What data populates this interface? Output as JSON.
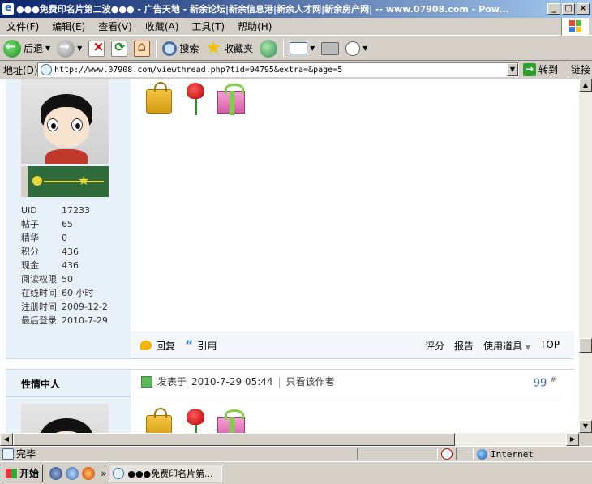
{
  "window": {
    "title": "●●●免费印名片第二波●●● - 广告天地 - 新余论坛|新余信息港|新余人才网|新余房产网| -- www.07908.com - Pow..."
  },
  "menu": [
    "文件(F)",
    "编辑(E)",
    "查看(V)",
    "收藏(A)",
    "工具(T)",
    "帮助(H)"
  ],
  "toolbar": {
    "back": "后退",
    "search": "搜索",
    "favorites": "收藏夹"
  },
  "address": {
    "label": "地址(D)",
    "url": "http://www.07908.com/viewthread.php?tid=94795&extra=&page=5",
    "go": "转到",
    "links": "链接"
  },
  "post1": {
    "stats": [
      {
        "k": "UID",
        "v": "17233"
      },
      {
        "k": "帖子",
        "v": "65"
      },
      {
        "k": "精华",
        "v": "0"
      },
      {
        "k": "积分",
        "v": "436"
      },
      {
        "k": "现金",
        "v": "436"
      },
      {
        "k": "阅读权限",
        "v": "50"
      },
      {
        "k": "在线时间",
        "v": "60 小时"
      },
      {
        "k": "注册时间",
        "v": "2009-12-2"
      },
      {
        "k": "最后登录",
        "v": "2010-7-29"
      }
    ],
    "actions": {
      "reply": "回复",
      "quote": "引用",
      "rate": "评分",
      "report": "报告",
      "tools": "使用道具",
      "top": "TOP"
    }
  },
  "post2": {
    "author": "性情中人",
    "posted_label": "发表于",
    "posted_time": "2010-7-29 05:44",
    "only_author": "只看该作者",
    "floor": "99",
    "floor_suffix": "#"
  },
  "status": {
    "text": "完毕",
    "zone": "Internet"
  },
  "taskbar": {
    "start": "开始",
    "task_title": "●●●免费印名片第..."
  }
}
